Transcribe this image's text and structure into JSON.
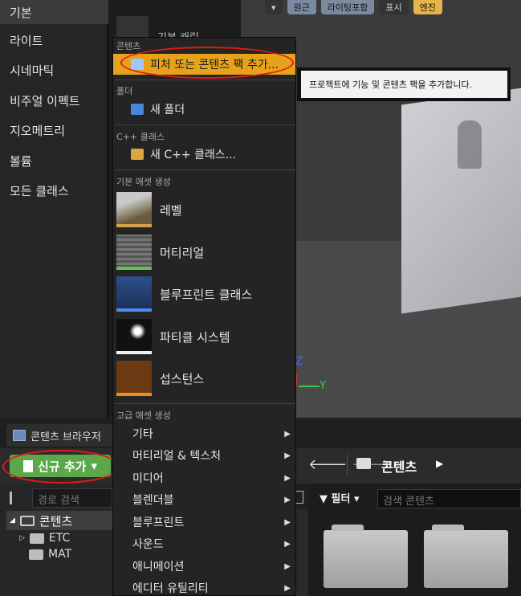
{
  "viewport_toolbar": [
    "원근",
    "라이팅포함",
    "표시",
    "엔진"
  ],
  "axes": {
    "z": "Z",
    "y": "Y"
  },
  "categories": {
    "selected": "기본",
    "items": [
      "라이트",
      "시네마틱",
      "비주얼 이펙트",
      "지오메트리",
      "볼륨",
      "모든 클래스"
    ],
    "peek_item": "기본 캐릭"
  },
  "menu": {
    "section_content": "콘텐츠",
    "add_feature": "피처 또는 콘텐츠 팩 추가...",
    "section_folder": "폴더",
    "new_folder": "새 폴더",
    "section_cpp": "C++ 클래스",
    "new_cpp": "새 C++ 클래스...",
    "section_basic_assets": "기본 애셋 생성",
    "basic_assets": [
      {
        "label": "레벨",
        "color": "#d7a24a"
      },
      {
        "label": "머티리얼",
        "color": "#5cc44f"
      },
      {
        "label": "블루프린트 클래스",
        "color": "#4b8cf0"
      },
      {
        "label": "파티클 시스템",
        "color": "#f0f0f0"
      },
      {
        "label": "섭스턴스",
        "color": "#f08a1e"
      }
    ],
    "section_advanced_assets": "고급 애셋 생성",
    "advanced_assets": [
      "기타",
      "머티리얼 & 텍스처",
      "미디어",
      "블렌더블",
      "블루프린트",
      "사운드",
      "애니메이션",
      "에디터 유틸리티"
    ]
  },
  "tooltip": "프로젝트에 기능 및 콘텐츠 팩을 추가합니다.",
  "content_browser": {
    "tab": "콘텐츠 브라우저",
    "add_new": "신규 추가",
    "path_search_placeholder": "경로 검색",
    "path_root": "콘텐츠",
    "filter": "필터",
    "content_search_placeholder": "검색 콘텐츠",
    "tree": {
      "root": "콘텐츠",
      "children": [
        "ETC",
        "MAT"
      ]
    }
  }
}
